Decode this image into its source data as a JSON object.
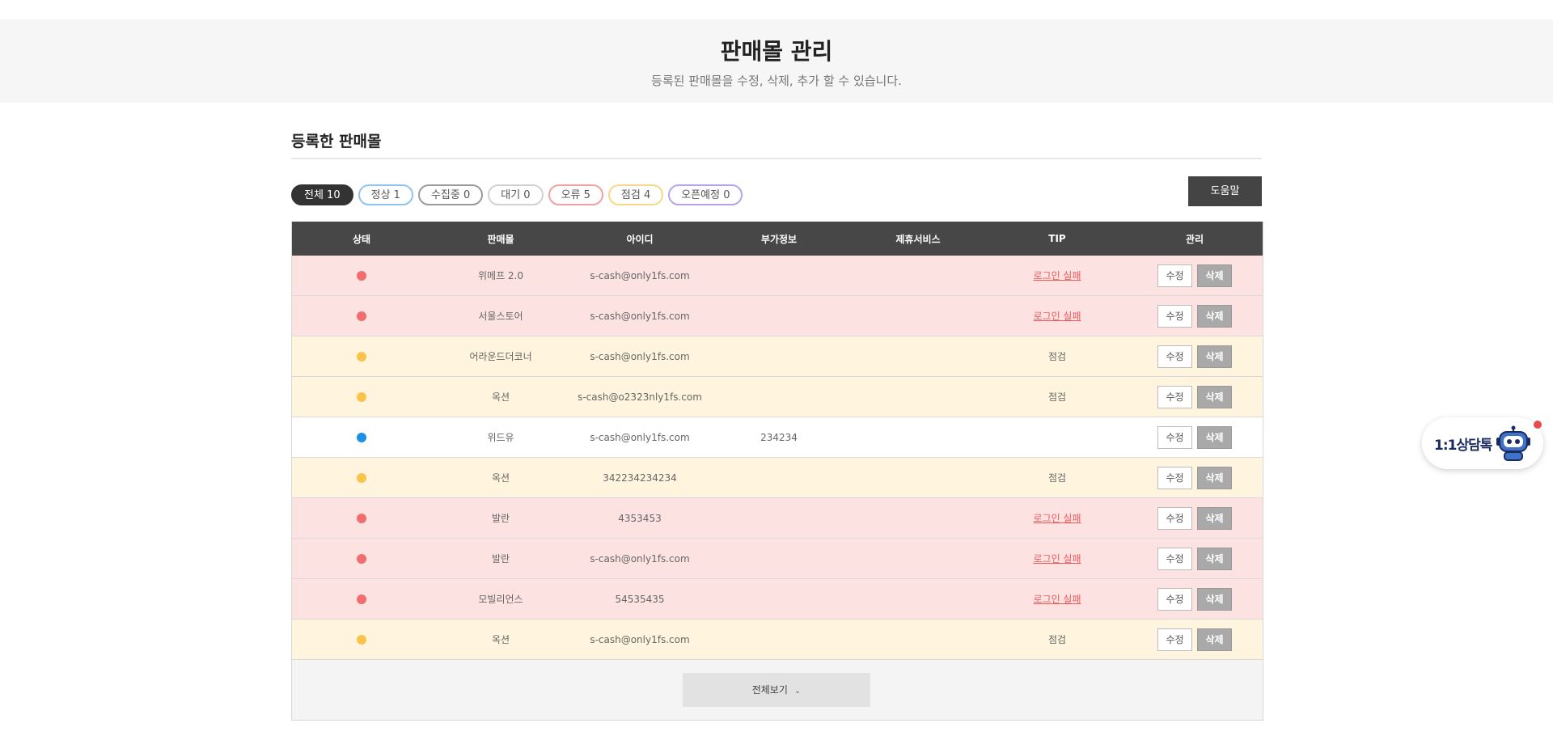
{
  "header": {
    "title": "판매몰 관리",
    "subtitle": "등록된 판매몰을 수정, 삭제, 추가 할 수 있습니다."
  },
  "section": {
    "title": "등록한 판매몰"
  },
  "filters": [
    {
      "label": "전체 10",
      "key": "all"
    },
    {
      "label": "정상 1",
      "key": "normal"
    },
    {
      "label": "수집중 0",
      "key": "collect"
    },
    {
      "label": "대기 0",
      "key": "wait"
    },
    {
      "label": "오류 5",
      "key": "error"
    },
    {
      "label": "점검 4",
      "key": "check"
    },
    {
      "label": "오픈예정 0",
      "key": "open"
    }
  ],
  "help_label": "도움말",
  "status_colors": {
    "error": "#f26d6d",
    "check": "#fcc34a",
    "normal": "#1e8fe6"
  },
  "table": {
    "headers": {
      "status": "상태",
      "mall": "판매몰",
      "id": "아이디",
      "extra": "부가정보",
      "service": "제휴서비스",
      "tip": "TIP",
      "manage": "관리"
    },
    "edit_label": "수정",
    "delete_label": "삭제",
    "rows": [
      {
        "status": "error",
        "mall": "위메프 2.0",
        "id": "s-cash@only1fs.com",
        "extra": "",
        "service": "",
        "tip": "로그인 실패"
      },
      {
        "status": "error",
        "mall": "서울스토어",
        "id": "s-cash@only1fs.com",
        "extra": "",
        "service": "",
        "tip": "로그인 실패"
      },
      {
        "status": "check",
        "mall": "어라운드더코너",
        "id": "s-cash@only1fs.com",
        "extra": "",
        "service": "",
        "tip": "점검"
      },
      {
        "status": "check",
        "mall": "옥션",
        "id": "s-cash@o2323nly1fs.com",
        "extra": "",
        "service": "",
        "tip": "점검"
      },
      {
        "status": "normal",
        "mall": "위드유",
        "id": "s-cash@only1fs.com",
        "extra": "234234",
        "service": "",
        "tip": ""
      },
      {
        "status": "check",
        "mall": "옥션",
        "id": "342234234234",
        "extra": "",
        "service": "",
        "tip": "점검"
      },
      {
        "status": "error",
        "mall": "발란",
        "id": "4353453",
        "extra": "",
        "service": "",
        "tip": "로그인 실패"
      },
      {
        "status": "error",
        "mall": "발란",
        "id": "s-cash@only1fs.com",
        "extra": "",
        "service": "",
        "tip": "로그인 실패"
      },
      {
        "status": "error",
        "mall": "모빌리언스",
        "id": "54535435",
        "extra": "",
        "service": "",
        "tip": "로그인 실패"
      },
      {
        "status": "check",
        "mall": "옥션",
        "id": "s-cash@only1fs.com",
        "extra": "",
        "service": "",
        "tip": "점검"
      }
    ]
  },
  "view_all_label": "전체보기",
  "chat": {
    "label": "1:1상담톡"
  }
}
